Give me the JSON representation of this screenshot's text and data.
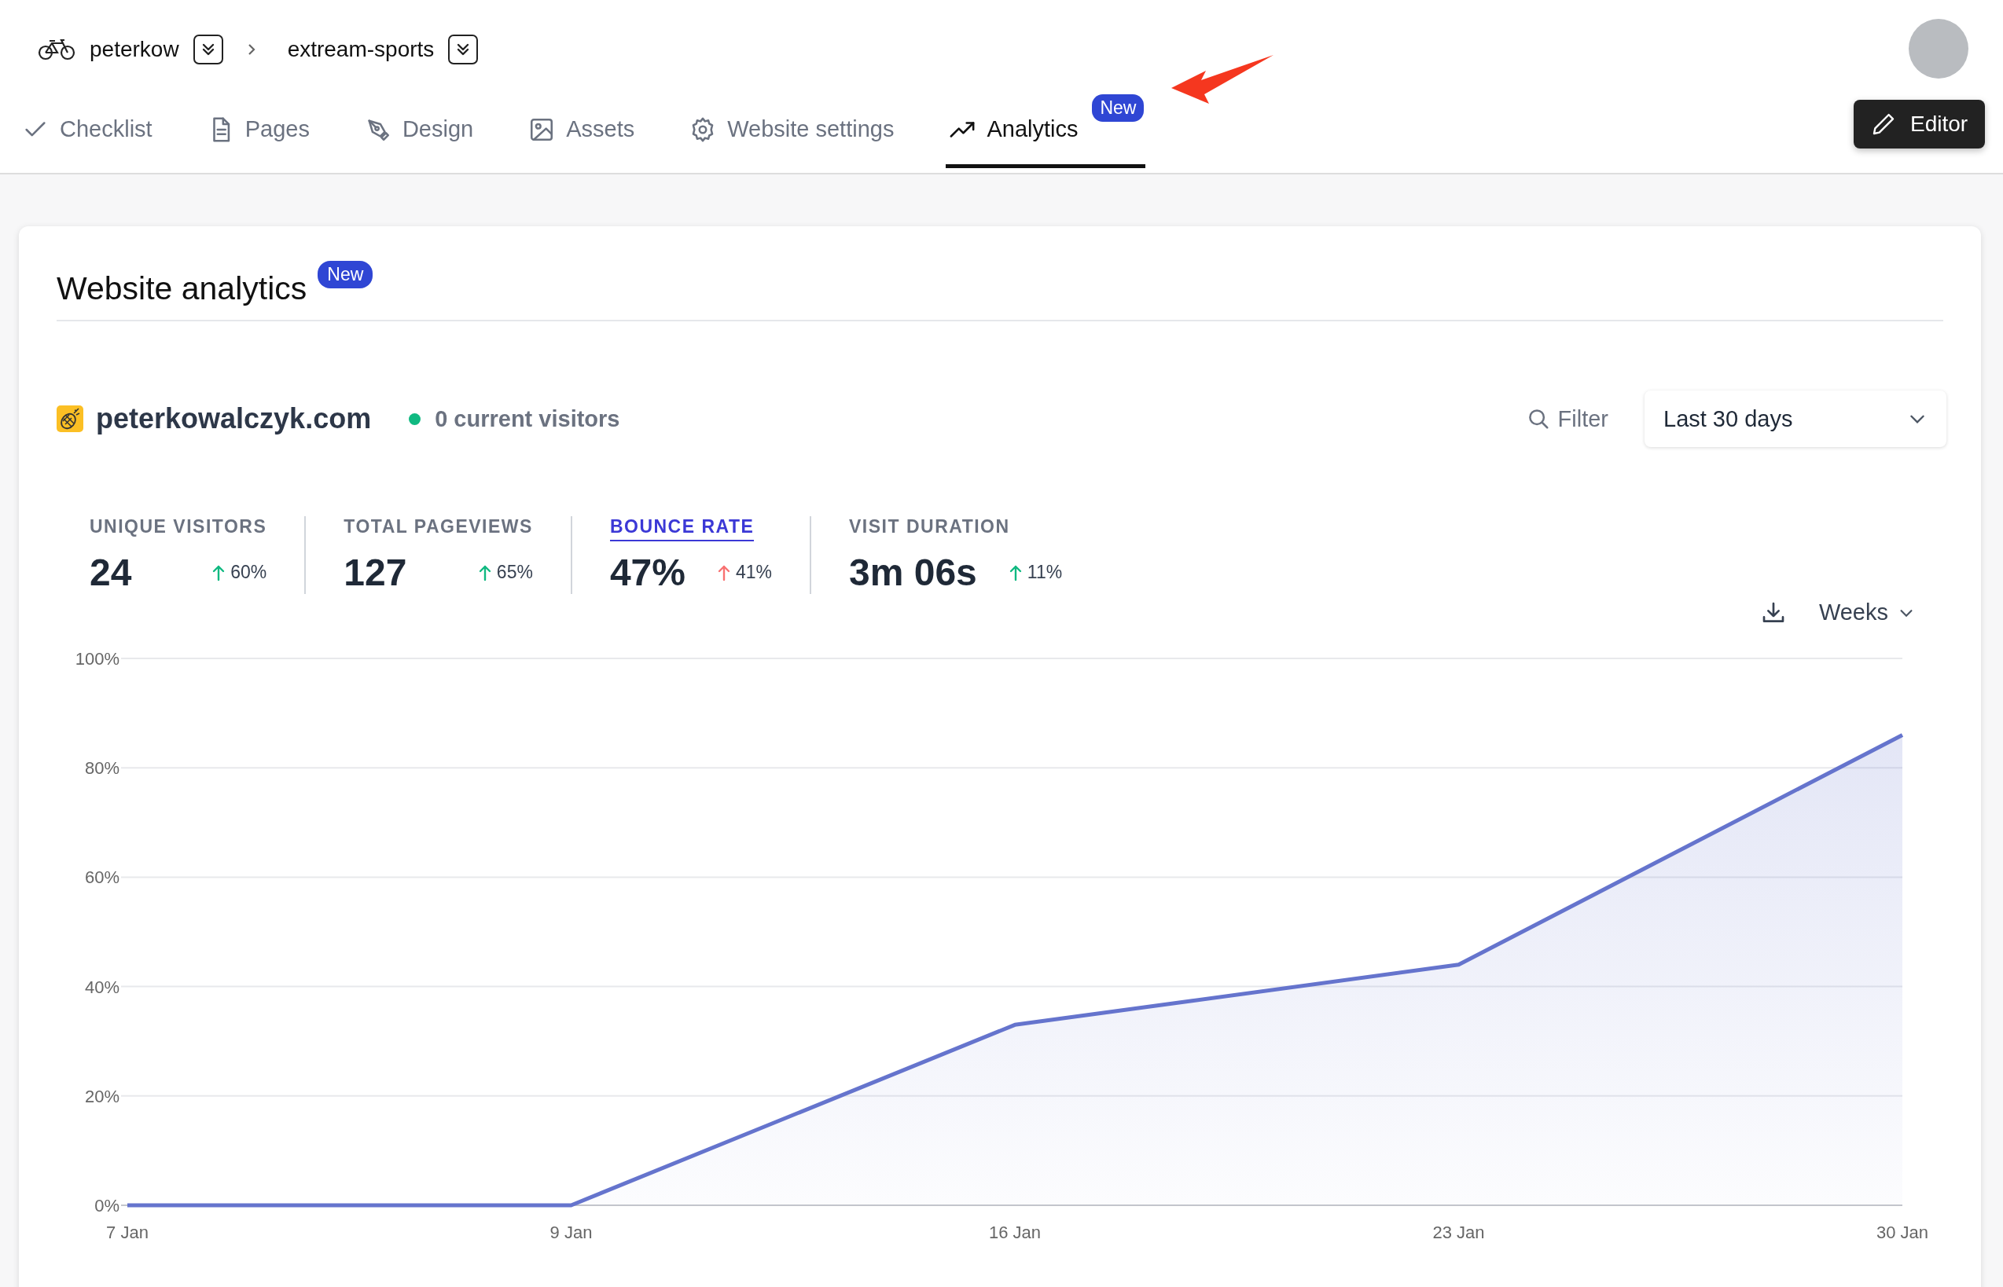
{
  "breadcrumb": [
    {
      "label": "peterkow"
    },
    {
      "label": "extream-sports"
    }
  ],
  "tabs": [
    {
      "label": "Checklist",
      "selected": false
    },
    {
      "label": "Pages",
      "selected": false
    },
    {
      "label": "Design",
      "selected": false
    },
    {
      "label": "Assets",
      "selected": false
    },
    {
      "label": "Website settings",
      "selected": false
    },
    {
      "label": "Analytics",
      "selected": true,
      "badge": "New"
    }
  ],
  "editor_button": "Editor",
  "panel": {
    "title": "Website analytics",
    "badge": "New",
    "site": "peterkowalczyk.com",
    "current_visitors": "0 current visitors",
    "filter": "Filter",
    "date_range": "Last 30 days",
    "interval": "Weeks",
    "stats": [
      {
        "label": "UNIQUE VISITORS",
        "value": "24",
        "change": "60%",
        "color": "#10b981",
        "selected": false
      },
      {
        "label": "TOTAL PAGEVIEWS",
        "value": "127",
        "change": "65%",
        "color": "#10b981",
        "selected": false
      },
      {
        "label": "BOUNCE RATE",
        "value": "47%",
        "change": "41%",
        "color": "#f87171",
        "selected": true
      },
      {
        "label": "VISIT DURATION",
        "value": "3m 06s",
        "change": "11%",
        "color": "#10b981",
        "selected": false
      }
    ],
    "chart_data": {
      "type": "area",
      "categories": [
        "7 Jan",
        "9 Jan",
        "16 Jan",
        "23 Jan",
        "30 Jan"
      ],
      "series": [
        {
          "color": "#6574cd",
          "values": [
            0,
            0,
            33,
            44,
            86
          ]
        }
      ],
      "grid": true,
      "ylim": [
        0,
        100
      ],
      "yticks": [
        {
          "value": 0,
          "label": "0%"
        },
        {
          "value": 20,
          "label": "20%"
        },
        {
          "value": 40,
          "label": "40%"
        },
        {
          "value": 60,
          "label": "60%"
        },
        {
          "value": 80,
          "label": "80%"
        },
        {
          "value": 100,
          "label": "100%"
        }
      ]
    }
  }
}
